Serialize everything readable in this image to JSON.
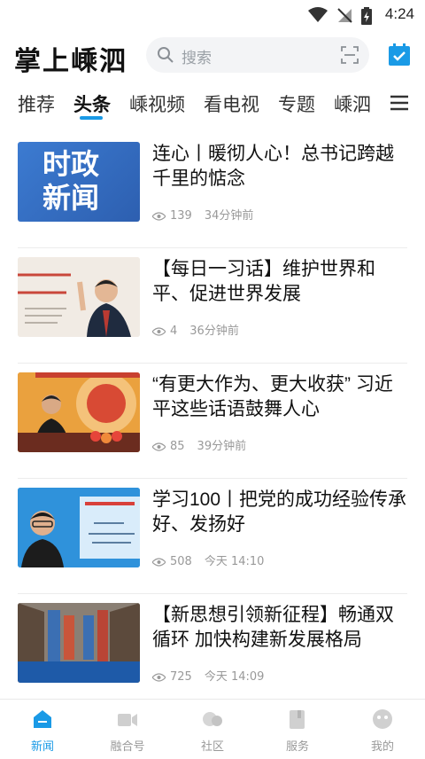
{
  "status_bar": {
    "time": "4:24"
  },
  "header": {
    "logo": "掌上嵊泗",
    "search_placeholder": "搜索"
  },
  "tabs": [
    "推荐",
    "头条",
    "嵊视频",
    "看电视",
    "专题",
    "嵊泗"
  ],
  "active_tab": "头条",
  "news": [
    {
      "title": "连心丨暖彻人心！总书记跨越千里的惦念",
      "views": "139",
      "time": "34分钟前",
      "thumb_text": "时政\n新闻"
    },
    {
      "title": "【每日一习话】维护世界和平、促进世界发展",
      "views": "4",
      "time": "36分钟前"
    },
    {
      "title": "“有更大作为、更大收获” 习近平这些话语鼓舞人心",
      "views": "85",
      "time": "39分钟前"
    },
    {
      "title": "学习100丨把党的成功经验传承好、发扬好",
      "views": "508",
      "time": "今天 14:10"
    },
    {
      "title": "【新思想引领新征程】畅通双循环 加快构建新发展格局",
      "views": "725",
      "time": "今天 14:09"
    }
  ],
  "bottom_nav": [
    "新闻",
    "融合号",
    "社区",
    "服务",
    "我的"
  ],
  "colors": {
    "accent": "#1a9ae6",
    "muted": "#999999"
  }
}
